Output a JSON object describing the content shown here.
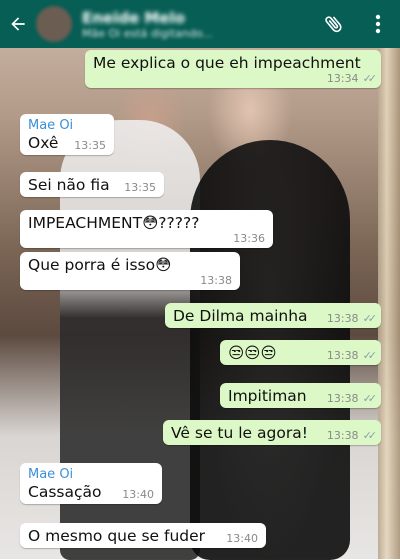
{
  "header": {
    "contact_name": "Eneide Melo",
    "contact_status": "Mãe Oi está digitando..."
  },
  "messages": [
    {
      "dir": "out",
      "text": "Me explica o que eh impeachment",
      "time": "13:34",
      "read": true
    },
    {
      "dir": "in",
      "sender": "Mae Oi",
      "text": "Oxê",
      "time": "13:35"
    },
    {
      "dir": "in",
      "text": "Sei não fia",
      "time": "13:35"
    },
    {
      "dir": "in",
      "text": "IMPEACHMENT😳?????",
      "time": "13:36"
    },
    {
      "dir": "in",
      "text": "Que porra é isso😳",
      "time": "13:38"
    },
    {
      "dir": "out",
      "text": "De Dilma mainha",
      "time": "13:38",
      "read": true
    },
    {
      "dir": "out",
      "text": "😒😒😒",
      "time": "13:38",
      "read": true
    },
    {
      "dir": "out",
      "text": "Impitiman",
      "time": "13:38",
      "read": true
    },
    {
      "dir": "out",
      "text": "Vê se tu le agora!",
      "time": "13:38",
      "read": true
    },
    {
      "dir": "in",
      "sender": "Mae Oi",
      "text": "Cassação",
      "time": "13:40"
    },
    {
      "dir": "in",
      "text": "O mesmo que se fuder",
      "time": "13:40"
    }
  ],
  "colors": {
    "topbar": "#075e54",
    "incoming_bubble": "#ffffff",
    "outgoing_bubble": "#dcf8c6",
    "sender_name": "#3b8fd6"
  },
  "icons": {
    "back": "arrow-left-icon",
    "attach": "paperclip-icon",
    "menu": "more-vertical-icon",
    "read": "double-check-icon"
  }
}
